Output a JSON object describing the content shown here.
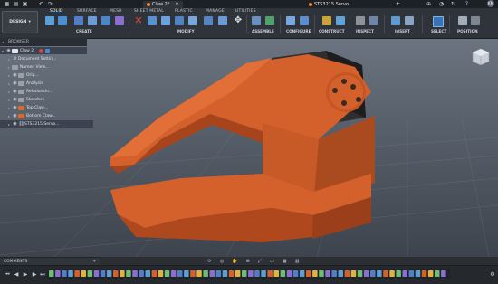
{
  "titlebar": {
    "doc_tabs": [
      {
        "label": "Claw 2*"
      },
      {
        "label": "STS3215 Servo"
      }
    ],
    "user_initials": "KM"
  },
  "ribbon": {
    "workspace_button": "DESIGN",
    "workspace_tabs": [
      "SOLID",
      "SURFACE",
      "MESH",
      "SHEET METAL",
      "PLASTIC",
      "MANAGE",
      "UTILITIES"
    ],
    "groups": [
      "CREATE",
      "MODIFY",
      "ASSEMBLE",
      "CONFIGURE",
      "CONSTRUCT",
      "INSPECT",
      "INSERT",
      "SELECT",
      "POSITION"
    ]
  },
  "browser": {
    "header": "BROWSER",
    "root": "Claw 2",
    "items": [
      {
        "label": "Document Settin...",
        "type": "settings"
      },
      {
        "label": "Named View...",
        "type": "folder"
      },
      {
        "label": "Orig...",
        "type": "folder"
      },
      {
        "label": "Analysis",
        "type": "folder"
      },
      {
        "label": "Relationshi...",
        "type": "folder"
      },
      {
        "label": "Sketches",
        "type": "folder"
      },
      {
        "label": "Top Claw...",
        "type": "component"
      },
      {
        "label": "Bottom Claw...",
        "type": "component"
      },
      {
        "label": "STS3215 Servo...",
        "type": "link"
      }
    ]
  },
  "comments": {
    "label": "COMMENTS"
  },
  "colors": {
    "part": "#d4602c",
    "part_dark": "#a8441b",
    "servo": "#2b2b2b",
    "accent": "#4aa3ff"
  }
}
